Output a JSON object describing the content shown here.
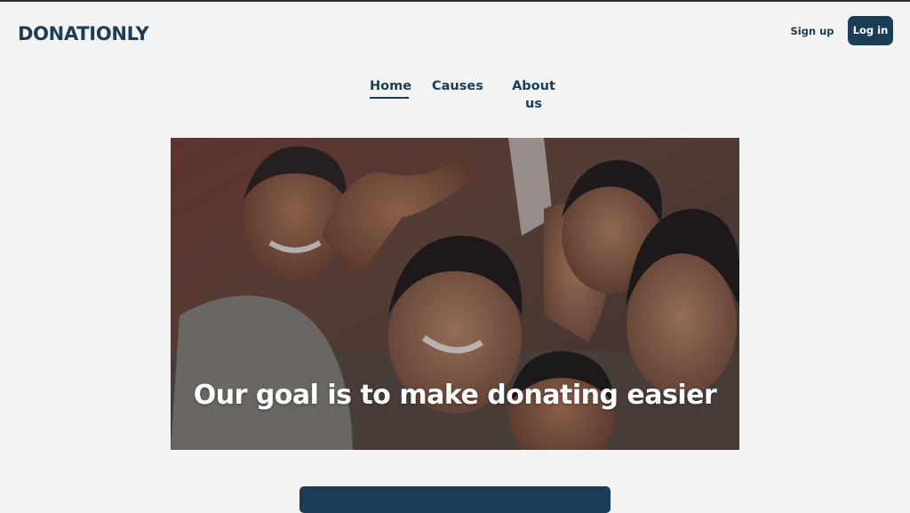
{
  "brand": {
    "logo_text": "DONATIONLY",
    "primary_color": "#1c3d57",
    "background_color": "#f3f3f3"
  },
  "header": {
    "signup_label": "Sign up",
    "login_label": "Log in"
  },
  "nav": {
    "items": [
      {
        "label": "Home",
        "active": true
      },
      {
        "label": "Causes",
        "active": false
      },
      {
        "label": "About us",
        "active": false
      }
    ]
  },
  "hero": {
    "title": "Our goal is to make donating easier",
    "image_icon": "children-photo"
  },
  "cta": {
    "label": ""
  }
}
